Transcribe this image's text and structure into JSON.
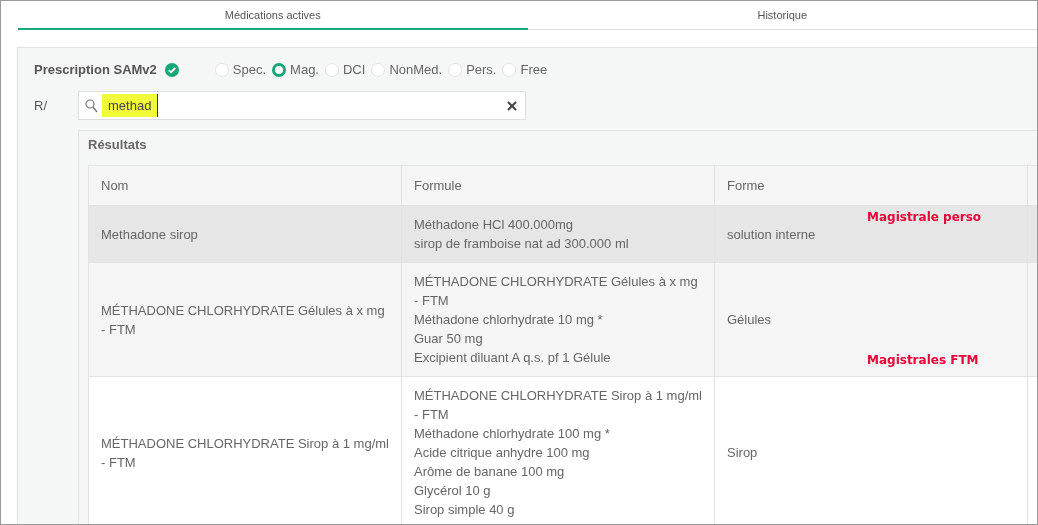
{
  "tabs": [
    {
      "label": "Médications actives",
      "selected": true
    },
    {
      "label": "Historique",
      "selected": false
    }
  ],
  "prescription": {
    "label": "Prescription SAMv2",
    "verified": true
  },
  "types": [
    {
      "label": "Spec.",
      "selected": false
    },
    {
      "label": "Mag.",
      "selected": true
    },
    {
      "label": "DCI",
      "selected": false
    },
    {
      "label": "NonMed.",
      "selected": false
    },
    {
      "label": "Pers.",
      "selected": false
    },
    {
      "label": "Free",
      "selected": false
    }
  ],
  "search": {
    "label": "R/",
    "value": "methad"
  },
  "results": {
    "title": "Résultats",
    "columns": [
      "Nom",
      "Formule",
      "Forme"
    ],
    "rows": [
      {
        "selected": true,
        "nom": "Methadone sirop",
        "formule": [
          "Méthadone HCl 400.000mg",
          "sirop de framboise nat ad 300.000 ml"
        ],
        "forme": "solution interne",
        "annotation": "Magistrale perso"
      },
      {
        "selected": false,
        "nom": "MÉTHADONE CHLORHYDRATE Gélules à x mg - FTM",
        "formule": [
          "MÉTHADONE CHLORHYDRATE Gélules à x mg - FTM",
          "Méthadone chlorhydrate 10 mg *",
          "Guar 50 mg",
          "Excipient diluant A q.s. pf 1 Gélule"
        ],
        "forme": "Gélules",
        "annotation": "Magistrales FTM"
      },
      {
        "selected": false,
        "nom": "MÉTHADONE CHLORHYDRATE Sirop à 1 mg/ml - FTM",
        "formule": [
          "MÉTHADONE CHLORHYDRATE Sirop à 1 mg/ml - FTM",
          "Méthadone chlorhydrate 100 mg *",
          "Acide citrique anhydre 100 mg",
          "Arôme de banane 100 mg",
          "Glycérol 10 g",
          "Sirop simple 40 g"
        ],
        "forme": "Sirop"
      }
    ]
  }
}
